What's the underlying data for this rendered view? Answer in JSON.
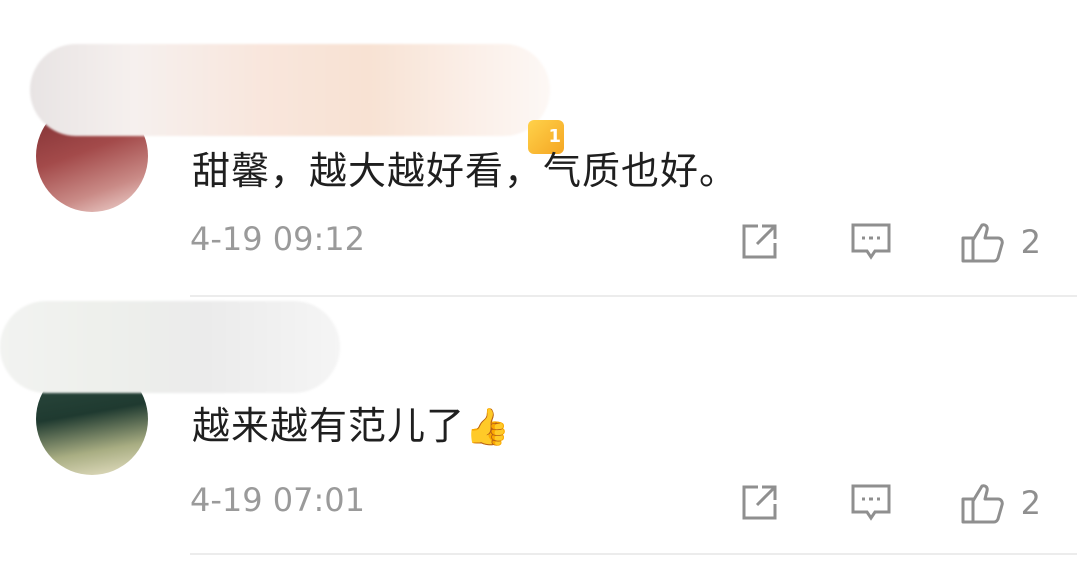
{
  "top_hint": "",
  "comments": [
    {
      "username": "",
      "text": "甜馨，越大越好看，气质也好。",
      "time": "4-19 09:12",
      "likes": "2"
    },
    {
      "username": "",
      "text": "越来越有范儿了",
      "emoji": "👍",
      "time": "4-19 07:01",
      "likes": "2"
    }
  ],
  "colors": {
    "meta": "#9a9a9a",
    "icon": "#8f8f8f",
    "divider": "#ececec"
  }
}
